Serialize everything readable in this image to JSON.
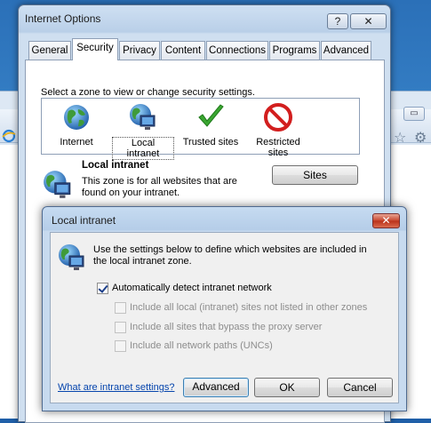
{
  "window": {
    "title": "Internet Options",
    "help_label": "?",
    "close_label": "✕"
  },
  "tabs": [
    {
      "label": "General"
    },
    {
      "label": "Security"
    },
    {
      "label": "Privacy"
    },
    {
      "label": "Content"
    },
    {
      "label": "Connections"
    },
    {
      "label": "Programs"
    },
    {
      "label": "Advanced"
    }
  ],
  "active_tab": "Security",
  "security": {
    "instruction": "Select a zone to view or change security settings.",
    "zones": [
      {
        "label": "Internet",
        "icon": "globe-icon"
      },
      {
        "label": "Local intranet",
        "icon": "intranet-icon"
      },
      {
        "label": "Trusted sites",
        "icon": "checkmark-icon"
      },
      {
        "label": "Restricted sites",
        "icon": "no-entry-icon"
      }
    ],
    "selected_zone": "Local intranet",
    "zone_title": "Local intranet",
    "zone_description": "This zone is for all websites that are found on your intranet.",
    "sites_button": "Sites"
  },
  "dialog": {
    "title": "Local intranet",
    "close_label": "✕",
    "description": "Use the settings below to define which websites are included in the local intranet zone.",
    "options": [
      {
        "label": "Automatically detect intranet network",
        "checked": true,
        "enabled": true
      },
      {
        "label": "Include all local (intranet) sites not listed in other zones",
        "checked": false,
        "enabled": false
      },
      {
        "label": "Include all sites that bypass the proxy server",
        "checked": false,
        "enabled": false
      },
      {
        "label": "Include all network paths (UNCs)",
        "checked": false,
        "enabled": false
      }
    ],
    "help_link": "What are intranet settings?",
    "advanced_button": "Advanced",
    "ok_button": "OK",
    "cancel_button": "Cancel"
  },
  "colors": {
    "link": "#0645ad",
    "title_bar": "#b9cfe8",
    "close_red": "#c7452d"
  }
}
